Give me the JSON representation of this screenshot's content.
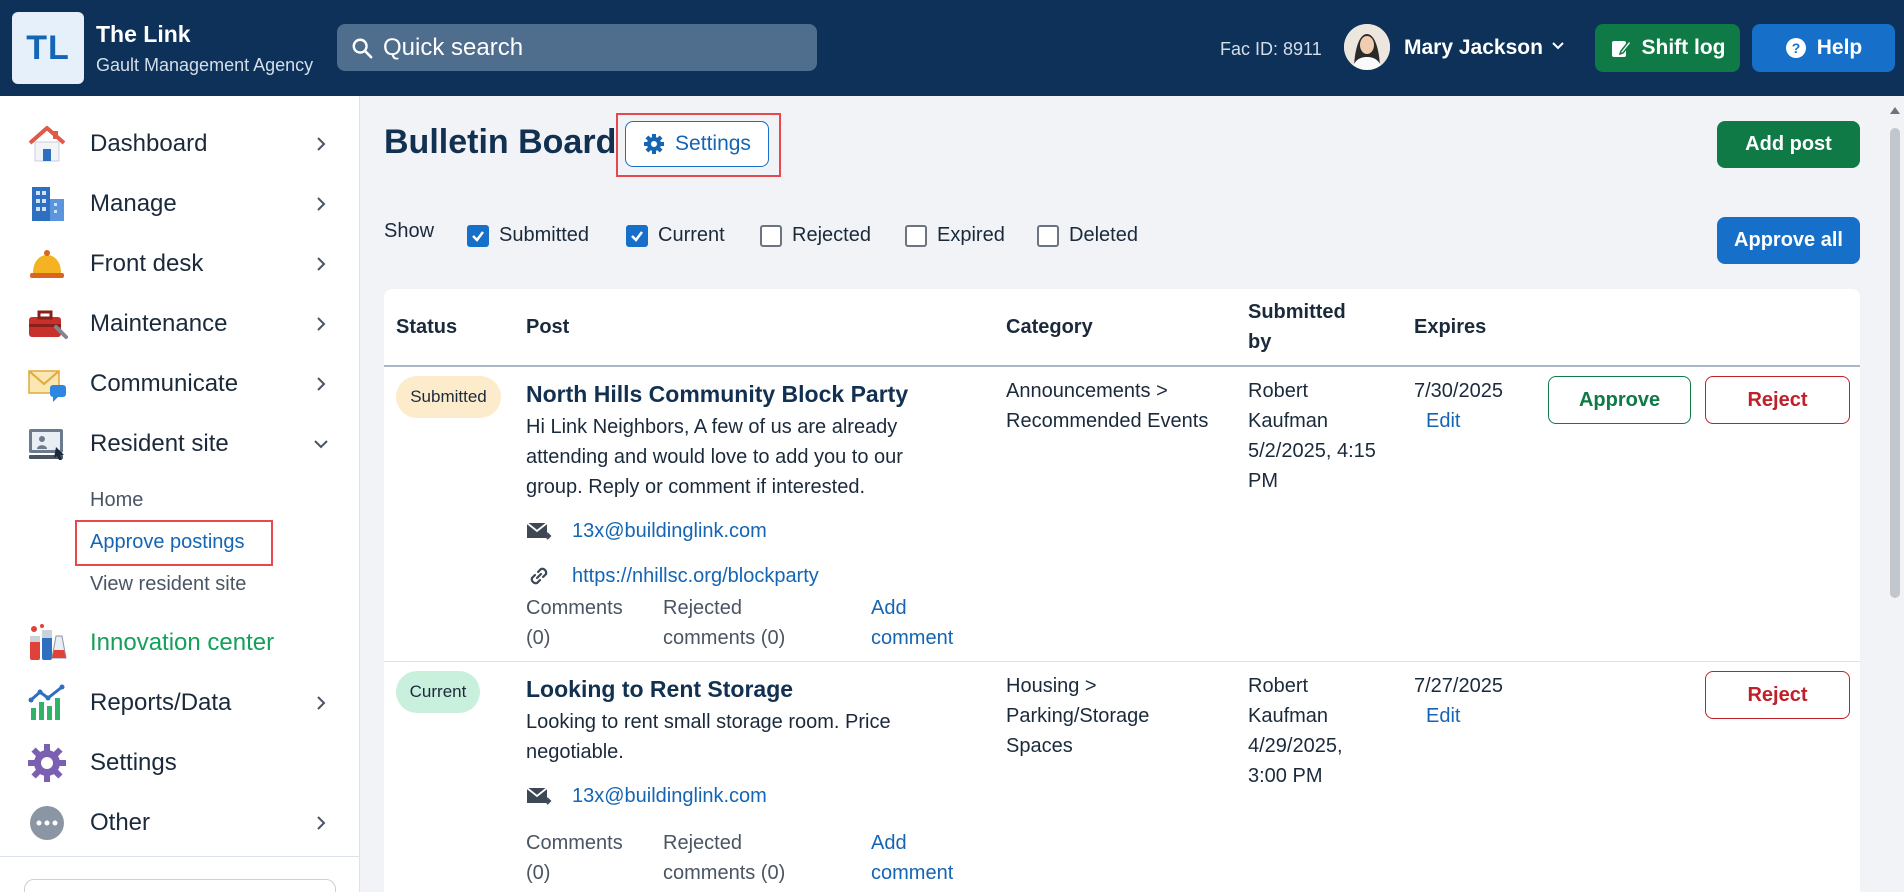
{
  "header": {
    "logo": "TL",
    "org_name": "The Link",
    "org_sub": "Gault Management Agency",
    "search_placeholder": "Quick search",
    "fac_id": "Fac ID: 8911",
    "user_name": "Mary Jackson",
    "shift_log": "Shift log",
    "help": "Help",
    "brand_color": "#0d3158"
  },
  "sidebar": {
    "items": [
      {
        "label": "Dashboard",
        "icon": "house-icon"
      },
      {
        "label": "Manage",
        "icon": "building-icon"
      },
      {
        "label": "Front desk",
        "icon": "service-bell-icon"
      },
      {
        "label": "Maintenance",
        "icon": "toolbox-icon"
      },
      {
        "label": "Communicate",
        "icon": "envelope-chat-icon"
      },
      {
        "label": "Resident site",
        "icon": "computer-icon"
      },
      {
        "label": "Innovation center",
        "icon": "lab-flasks-icon"
      },
      {
        "label": "Reports/Data",
        "icon": "bar-chart-icon"
      },
      {
        "label": "Settings",
        "icon": "gear-icon"
      },
      {
        "label": "Other",
        "icon": "more-dots-icon"
      }
    ],
    "resident_sub": {
      "home": "Home",
      "approve_postings": "Approve postings",
      "view_site": "View resident site"
    }
  },
  "main": {
    "title": "Bulletin Board",
    "settings_button": "Settings",
    "add_post": "Add post",
    "approve_all": "Approve all",
    "show_label": "Show",
    "filters": [
      {
        "label": "Submitted",
        "checked": true
      },
      {
        "label": "Current",
        "checked": true
      },
      {
        "label": "Rejected",
        "checked": false
      },
      {
        "label": "Expired",
        "checked": false
      },
      {
        "label": "Deleted",
        "checked": false
      }
    ],
    "columns": {
      "status": "Status",
      "post": "Post",
      "category": "Category",
      "submitted_by_1": "Submitted",
      "submitted_by_2": "by",
      "expires": "Expires"
    },
    "rows": [
      {
        "status": "Submitted",
        "title": "North Hills Community Block Party",
        "body_1": "Hi Link Neighbors, A few of us are already",
        "body_2": "attending and would love to add you to our",
        "body_3": "group. Reply or comment if interested.",
        "email": "13x@buildinglink.com",
        "url": "https://nhillsc.org/blockparty",
        "comments_1": "Comments",
        "comments_2": "(0)",
        "rejected_1": "Rejected",
        "rejected_2": "comments (0)",
        "add_1": "Add",
        "add_2": "comment",
        "cat_1": "Announcements >",
        "cat_2": "Recommended Events",
        "by_1": "Robert",
        "by_2": "Kaufman",
        "by_3": "5/2/2025, 4:15",
        "by_4": "PM",
        "expires": "7/30/2025",
        "edit": "Edit",
        "approve": "Approve",
        "reject": "Reject"
      },
      {
        "status": "Current",
        "title": "Looking to Rent Storage",
        "body_1": "Looking to rent small storage room. Price",
        "body_2": "negotiable.",
        "email": "13x@buildinglink.com",
        "comments_1": "Comments",
        "comments_2": "(0)",
        "rejected_1": "Rejected",
        "rejected_2": "comments (0)",
        "add_1": "Add",
        "add_2": "comment",
        "cat_1": "Housing >",
        "cat_2": "Parking/Storage",
        "cat_3": "Spaces",
        "by_1": "Robert",
        "by_2": "Kaufman",
        "by_3": "4/29/2025,",
        "by_4": "3:00 PM",
        "expires": "7/27/2025",
        "edit": "Edit",
        "reject": "Reject"
      }
    ]
  }
}
